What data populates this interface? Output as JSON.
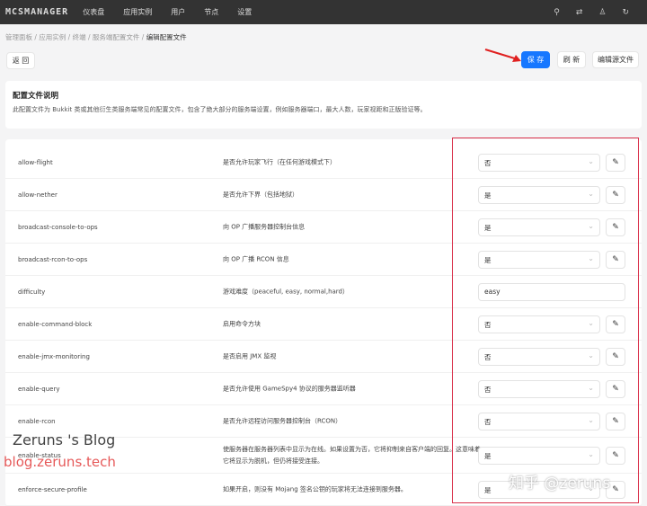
{
  "nav": {
    "logo": "MCSMANAGER",
    "items": [
      "仪表盘",
      "应用实例",
      "用户",
      "节点",
      "设置"
    ],
    "icons": [
      "theme-icon",
      "language-icon",
      "user-icon",
      "logout-icon"
    ]
  },
  "breadcrumb": [
    "管理面板",
    "应用实例",
    "终端",
    "服务端配置文件",
    "编辑配置文件"
  ],
  "toolbar": {
    "back": "返 回",
    "save": "保 存",
    "refresh": "刷 新",
    "edit_source": "编辑源文件"
  },
  "description": {
    "title": "配置文件说明",
    "text": "此配置文件为 Bukkit 类或其他衍生类服务端常见的配置文件，包含了绝大部分的服务端设置，例如服务器端口，最大人数，玩家视距和正版验证等。"
  },
  "rows": [
    {
      "key": "allow-flight",
      "info": "是否允许玩家飞行（在任何游戏模式下）",
      "value": "否",
      "type": "select"
    },
    {
      "key": "allow-nether",
      "info": "是否允许下界（包括地狱）",
      "value": "是",
      "type": "select"
    },
    {
      "key": "broadcast-console-to-ops",
      "info": "向 OP 广播服务器控制台信息",
      "value": "是",
      "type": "select"
    },
    {
      "key": "broadcast-rcon-to-ops",
      "info": "向 OP 广播 RCON 信息",
      "value": "是",
      "type": "select"
    },
    {
      "key": "difficulty",
      "info": "游戏难度（peaceful, easy, normal,hard）",
      "value": "easy",
      "type": "text"
    },
    {
      "key": "enable-command-block",
      "info": "启用命令方块",
      "value": "否",
      "type": "select"
    },
    {
      "key": "enable-jmx-monitoring",
      "info": "是否启用 JMX 监视",
      "value": "否",
      "type": "select"
    },
    {
      "key": "enable-query",
      "info": "是否允许使用 GameSpy4 协议的服务器监听器",
      "value": "否",
      "type": "select"
    },
    {
      "key": "enable-rcon",
      "info": "是否允许远程访问服务器控制台（RCON）",
      "value": "否",
      "type": "select"
    },
    {
      "key": "enable-status",
      "info": "使服务器在服务器列表中显示为在线。如果设置为否，它将抑制来自客户端的回复。这意味着它将显示为脱机，但仍将接受连接。",
      "value": "是",
      "type": "select"
    },
    {
      "key": "enforce-secure-profile",
      "info": "如果开启，则没有 Mojang 签名公钥的玩家将无法连接到服务器。",
      "value": "是",
      "type": "select"
    }
  ],
  "watermark": {
    "blog_name": "Zeruns 's Blog",
    "blog_url": "blog.zeruns.tech",
    "zhihu": "知乎 @zeruns"
  },
  "colors": {
    "primary": "#1677ff",
    "nav": "#333333",
    "highlight": "#d9304a"
  }
}
